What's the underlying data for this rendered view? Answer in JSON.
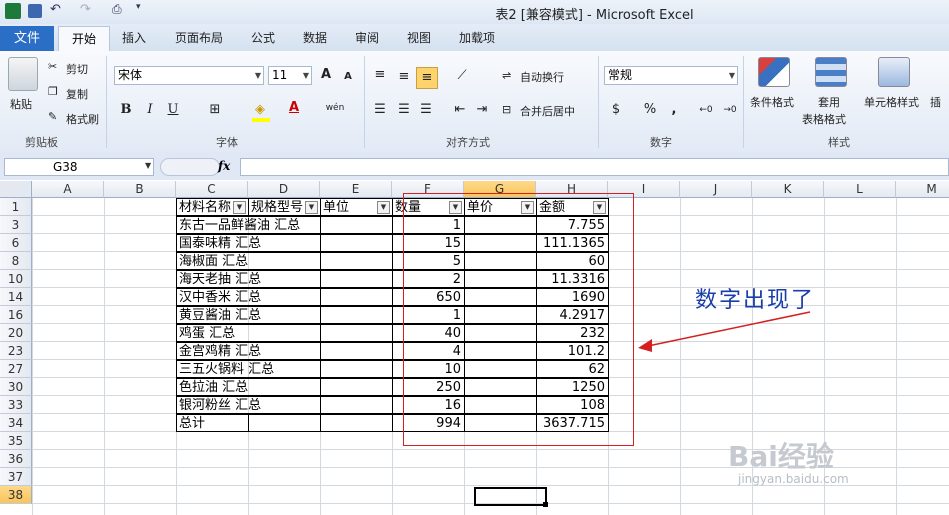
{
  "window": {
    "title": "表2  [兼容模式] - Microsoft Excel"
  },
  "tabs": {
    "file": "文件",
    "home": "开始",
    "insert": "插入",
    "layout": "页面布局",
    "formulas": "公式",
    "data": "数据",
    "review": "审阅",
    "view": "视图",
    "addins": "加载项"
  },
  "clipboard": {
    "paste": "粘贴",
    "cut": "剪切",
    "copy": "复制",
    "format_painter": "格式刷",
    "label": "剪贴板"
  },
  "font": {
    "name": "宋体",
    "size": "11",
    "bold": "B",
    "italic": "I",
    "underline": "U",
    "label": "字体",
    "grow": "A",
    "shrink": "A",
    "pinyin": "wén"
  },
  "alignment": {
    "wrap": "自动换行",
    "merge": "合并后居中",
    "label": "对齐方式"
  },
  "number": {
    "format": "常规",
    "percent": "%",
    "comma": ",",
    "label": "数字"
  },
  "styles": {
    "conditional": "条件格式",
    "table_a": "套用",
    "table_b": "表格格式",
    "cell_styles": "单元格样式",
    "label": "样式",
    "insert": "插"
  },
  "formula_bar": {
    "name_box": "G38",
    "fx": "fx"
  },
  "sheet": {
    "columns": [
      "A",
      "B",
      "C",
      "D",
      "E",
      "F",
      "G",
      "H",
      "I",
      "J",
      "K",
      "L",
      "M"
    ],
    "rows": [
      "1",
      "3",
      "6",
      "8",
      "10",
      "14",
      "16",
      "20",
      "23",
      "27",
      "30",
      "33",
      "34",
      "35",
      "36",
      "37",
      "38"
    ],
    "selected_column": "G",
    "selected_row": "38",
    "headers": [
      "材料名称",
      "规格型号",
      "单位",
      "数量",
      "单价",
      "金额"
    ],
    "data_rows": [
      {
        "name": "东古一品鲜酱油 汇总",
        "qty": "1",
        "amount": "7.755"
      },
      {
        "name": "国泰味精 汇总",
        "qty": "15",
        "amount": "111.1365"
      },
      {
        "name": "海椒面 汇总",
        "qty": "5",
        "amount": "60"
      },
      {
        "name": "海天老抽 汇总",
        "qty": "2",
        "amount": "11.3316"
      },
      {
        "name": "汉中香米 汇总",
        "qty": "650",
        "amount": "1690"
      },
      {
        "name": "黄豆酱油 汇总",
        "qty": "1",
        "amount": "4.2917"
      },
      {
        "name": "鸡蛋 汇总",
        "qty": "40",
        "amount": "232"
      },
      {
        "name": "金宫鸡精 汇总",
        "qty": "4",
        "amount": "101.2"
      },
      {
        "name": "三五火锅料 汇总",
        "qty": "10",
        "amount": "62"
      },
      {
        "name": "色拉油 汇总",
        "qty": "250",
        "amount": "1250"
      },
      {
        "name": "银河粉丝 汇总",
        "qty": "16",
        "amount": "108"
      },
      {
        "name": "总计",
        "qty": "994",
        "amount": "3637.715"
      }
    ]
  },
  "annotation": {
    "text": "数字出现了",
    "color": "#d42020"
  },
  "watermark": {
    "brand": "Bai经验",
    "url": "jingyan.baidu.com"
  },
  "colors": {
    "file_tab": "#2a6fc5",
    "selected_header": "#f8c55c",
    "annotation_box": "#d42020"
  }
}
